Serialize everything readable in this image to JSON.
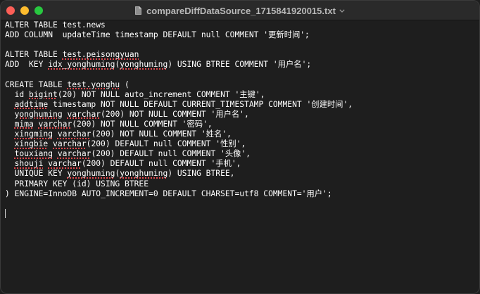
{
  "window": {
    "title": "compareDiffDataSource_1715841920015.txt",
    "accent_colors": {
      "close": "#fe5f57",
      "minimize": "#febc2e",
      "zoom": "#28c840",
      "spellcheck_underline": "#e5484d"
    },
    "title_icon": "document-icon",
    "title_menu_icon": "chevron-down-icon"
  },
  "editor": {
    "lines": [
      {
        "segments": [
          {
            "text": "ALTER TABLE test.news"
          }
        ]
      },
      {
        "segments": [
          {
            "text": "ADD COLUMN  updateTime timestamp DEFAULT null COMMENT '更新时间';"
          }
        ]
      },
      {
        "segments": [
          {
            "text": ""
          }
        ]
      },
      {
        "segments": [
          {
            "text": "ALTER TABLE "
          },
          {
            "text": "test.peisongyuan",
            "spell": true
          }
        ]
      },
      {
        "segments": [
          {
            "text": "ADD  KEY "
          },
          {
            "text": "idx_yonghuming",
            "spell": true
          },
          {
            "text": "("
          },
          {
            "text": "yonghuming",
            "spell": true
          },
          {
            "text": ") USING BTREE COMMENT '用户名';"
          }
        ]
      },
      {
        "segments": [
          {
            "text": ""
          }
        ]
      },
      {
        "segments": [
          {
            "text": "CREATE TABLE "
          },
          {
            "text": "test.yonghu",
            "spell": true
          },
          {
            "text": " ("
          }
        ]
      },
      {
        "segments": [
          {
            "text": "  id "
          },
          {
            "text": "bigint",
            "spell": true
          },
          {
            "text": "(20) NOT NULL auto_increment COMMENT '主键',"
          }
        ]
      },
      {
        "segments": [
          {
            "text": "  "
          },
          {
            "text": "addtime",
            "spell": true
          },
          {
            "text": " timestamp NOT NULL DEFAULT CURRENT_TIMESTAMP COMMENT '创建时间',"
          }
        ]
      },
      {
        "segments": [
          {
            "text": "  "
          },
          {
            "text": "yonghuming",
            "spell": true
          },
          {
            "text": " "
          },
          {
            "text": "varchar",
            "spell": true
          },
          {
            "text": "(200) NOT NULL COMMENT '用户名',"
          }
        ]
      },
      {
        "segments": [
          {
            "text": "  "
          },
          {
            "text": "mima",
            "spell": true
          },
          {
            "text": " "
          },
          {
            "text": "varchar",
            "spell": true
          },
          {
            "text": "(200) NOT NULL COMMENT '密码',"
          }
        ]
      },
      {
        "segments": [
          {
            "text": "  "
          },
          {
            "text": "xingming",
            "spell": true
          },
          {
            "text": " "
          },
          {
            "text": "varchar",
            "spell": true
          },
          {
            "text": "(200) NOT NULL COMMENT '姓名',"
          }
        ]
      },
      {
        "segments": [
          {
            "text": "  "
          },
          {
            "text": "xingbie",
            "spell": true
          },
          {
            "text": " "
          },
          {
            "text": "varchar",
            "spell": true
          },
          {
            "text": "(200) DEFAULT null COMMENT '性别',"
          }
        ]
      },
      {
        "segments": [
          {
            "text": "  "
          },
          {
            "text": "touxiang",
            "spell": true
          },
          {
            "text": " "
          },
          {
            "text": "varchar",
            "spell": true
          },
          {
            "text": "(200) DEFAULT null COMMENT '头像',"
          }
        ]
      },
      {
        "segments": [
          {
            "text": "  "
          },
          {
            "text": "shouji",
            "spell": true
          },
          {
            "text": " "
          },
          {
            "text": "varchar",
            "spell": true
          },
          {
            "text": "(200) DEFAULT null COMMENT '手机',"
          }
        ]
      },
      {
        "segments": [
          {
            "text": "  UNIQUE KEY "
          },
          {
            "text": "yonghuming",
            "spell": true
          },
          {
            "text": "("
          },
          {
            "text": "yonghuming",
            "spell": true
          },
          {
            "text": ") USING BTREE,"
          }
        ]
      },
      {
        "segments": [
          {
            "text": "  PRIMARY KEY (id) USING BTREE"
          }
        ]
      },
      {
        "segments": [
          {
            "text": ") ENGINE=InnoDB AUTO_INCREMENT=0 DEFAULT CHARSET=utf8 COMMENT='用户';"
          }
        ]
      },
      {
        "segments": [
          {
            "text": ""
          }
        ]
      },
      {
        "segments": [
          {
            "text": ""
          }
        ],
        "cursor": true
      }
    ]
  }
}
